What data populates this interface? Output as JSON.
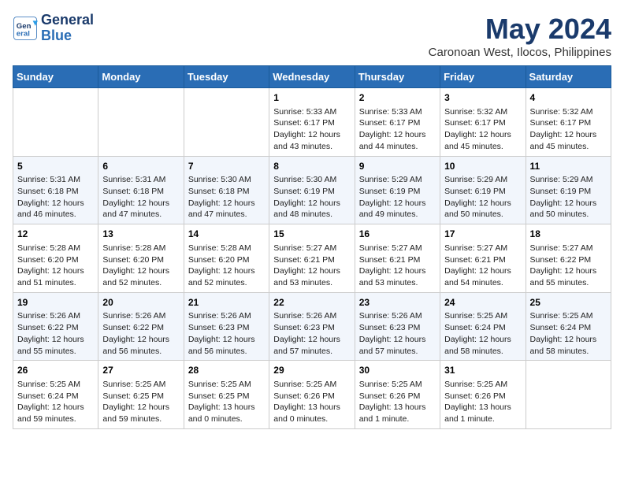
{
  "header": {
    "logo_line1": "General",
    "logo_line2": "Blue",
    "month": "May 2024",
    "location": "Caronoan West, Ilocos, Philippines"
  },
  "weekdays": [
    "Sunday",
    "Monday",
    "Tuesday",
    "Wednesday",
    "Thursday",
    "Friday",
    "Saturday"
  ],
  "weeks": [
    [
      {
        "day": "",
        "info": ""
      },
      {
        "day": "",
        "info": ""
      },
      {
        "day": "",
        "info": ""
      },
      {
        "day": "1",
        "info": "Sunrise: 5:33 AM\nSunset: 6:17 PM\nDaylight: 12 hours\nand 43 minutes."
      },
      {
        "day": "2",
        "info": "Sunrise: 5:33 AM\nSunset: 6:17 PM\nDaylight: 12 hours\nand 44 minutes."
      },
      {
        "day": "3",
        "info": "Sunrise: 5:32 AM\nSunset: 6:17 PM\nDaylight: 12 hours\nand 45 minutes."
      },
      {
        "day": "4",
        "info": "Sunrise: 5:32 AM\nSunset: 6:17 PM\nDaylight: 12 hours\nand 45 minutes."
      }
    ],
    [
      {
        "day": "5",
        "info": "Sunrise: 5:31 AM\nSunset: 6:18 PM\nDaylight: 12 hours\nand 46 minutes."
      },
      {
        "day": "6",
        "info": "Sunrise: 5:31 AM\nSunset: 6:18 PM\nDaylight: 12 hours\nand 47 minutes."
      },
      {
        "day": "7",
        "info": "Sunrise: 5:30 AM\nSunset: 6:18 PM\nDaylight: 12 hours\nand 47 minutes."
      },
      {
        "day": "8",
        "info": "Sunrise: 5:30 AM\nSunset: 6:19 PM\nDaylight: 12 hours\nand 48 minutes."
      },
      {
        "day": "9",
        "info": "Sunrise: 5:29 AM\nSunset: 6:19 PM\nDaylight: 12 hours\nand 49 minutes."
      },
      {
        "day": "10",
        "info": "Sunrise: 5:29 AM\nSunset: 6:19 PM\nDaylight: 12 hours\nand 50 minutes."
      },
      {
        "day": "11",
        "info": "Sunrise: 5:29 AM\nSunset: 6:19 PM\nDaylight: 12 hours\nand 50 minutes."
      }
    ],
    [
      {
        "day": "12",
        "info": "Sunrise: 5:28 AM\nSunset: 6:20 PM\nDaylight: 12 hours\nand 51 minutes."
      },
      {
        "day": "13",
        "info": "Sunrise: 5:28 AM\nSunset: 6:20 PM\nDaylight: 12 hours\nand 52 minutes."
      },
      {
        "day": "14",
        "info": "Sunrise: 5:28 AM\nSunset: 6:20 PM\nDaylight: 12 hours\nand 52 minutes."
      },
      {
        "day": "15",
        "info": "Sunrise: 5:27 AM\nSunset: 6:21 PM\nDaylight: 12 hours\nand 53 minutes."
      },
      {
        "day": "16",
        "info": "Sunrise: 5:27 AM\nSunset: 6:21 PM\nDaylight: 12 hours\nand 53 minutes."
      },
      {
        "day": "17",
        "info": "Sunrise: 5:27 AM\nSunset: 6:21 PM\nDaylight: 12 hours\nand 54 minutes."
      },
      {
        "day": "18",
        "info": "Sunrise: 5:27 AM\nSunset: 6:22 PM\nDaylight: 12 hours\nand 55 minutes."
      }
    ],
    [
      {
        "day": "19",
        "info": "Sunrise: 5:26 AM\nSunset: 6:22 PM\nDaylight: 12 hours\nand 55 minutes."
      },
      {
        "day": "20",
        "info": "Sunrise: 5:26 AM\nSunset: 6:22 PM\nDaylight: 12 hours\nand 56 minutes."
      },
      {
        "day": "21",
        "info": "Sunrise: 5:26 AM\nSunset: 6:23 PM\nDaylight: 12 hours\nand 56 minutes."
      },
      {
        "day": "22",
        "info": "Sunrise: 5:26 AM\nSunset: 6:23 PM\nDaylight: 12 hours\nand 57 minutes."
      },
      {
        "day": "23",
        "info": "Sunrise: 5:26 AM\nSunset: 6:23 PM\nDaylight: 12 hours\nand 57 minutes."
      },
      {
        "day": "24",
        "info": "Sunrise: 5:25 AM\nSunset: 6:24 PM\nDaylight: 12 hours\nand 58 minutes."
      },
      {
        "day": "25",
        "info": "Sunrise: 5:25 AM\nSunset: 6:24 PM\nDaylight: 12 hours\nand 58 minutes."
      }
    ],
    [
      {
        "day": "26",
        "info": "Sunrise: 5:25 AM\nSunset: 6:24 PM\nDaylight: 12 hours\nand 59 minutes."
      },
      {
        "day": "27",
        "info": "Sunrise: 5:25 AM\nSunset: 6:25 PM\nDaylight: 12 hours\nand 59 minutes."
      },
      {
        "day": "28",
        "info": "Sunrise: 5:25 AM\nSunset: 6:25 PM\nDaylight: 13 hours\nand 0 minutes."
      },
      {
        "day": "29",
        "info": "Sunrise: 5:25 AM\nSunset: 6:26 PM\nDaylight: 13 hours\nand 0 minutes."
      },
      {
        "day": "30",
        "info": "Sunrise: 5:25 AM\nSunset: 6:26 PM\nDaylight: 13 hours\nand 1 minute."
      },
      {
        "day": "31",
        "info": "Sunrise: 5:25 AM\nSunset: 6:26 PM\nDaylight: 13 hours\nand 1 minute."
      },
      {
        "day": "",
        "info": ""
      }
    ]
  ]
}
